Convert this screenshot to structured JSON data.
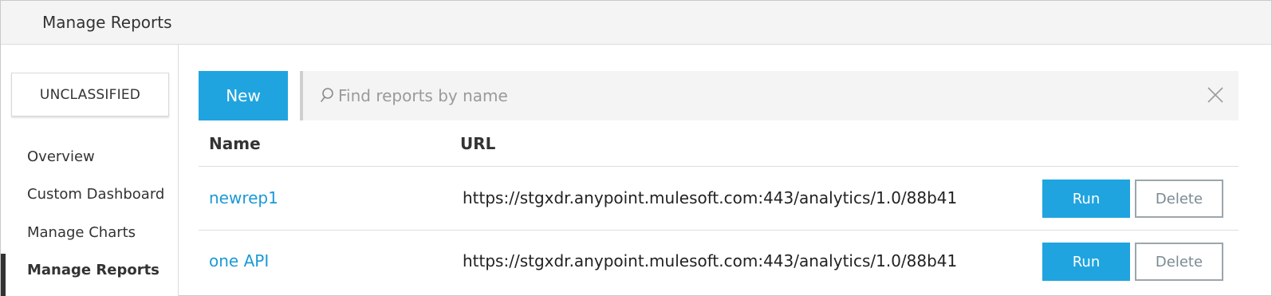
{
  "header": {
    "title": "Manage Reports"
  },
  "sidebar": {
    "environment_label": "UNCLASSIFIED",
    "items": [
      {
        "label": "Overview",
        "active": false
      },
      {
        "label": "Custom Dashboard",
        "active": false
      },
      {
        "label": "Manage Charts",
        "active": false
      },
      {
        "label": "Manage Reports",
        "active": true
      }
    ]
  },
  "toolbar": {
    "new_label": "New",
    "search": {
      "placeholder": "Find reports by name",
      "value": "",
      "icon": "search-icon",
      "clear_icon": "close-icon"
    }
  },
  "table": {
    "columns": [
      "Name",
      "URL"
    ],
    "rows": [
      {
        "name": "newrep1",
        "url": "https://stgxdr.anypoint.mulesoft.com:443/analytics/1.0/88b41",
        "run_label": "Run",
        "delete_label": "Delete"
      },
      {
        "name": "one API",
        "url": "https://stgxdr.anypoint.mulesoft.com:443/analytics/1.0/88b41",
        "run_label": "Run",
        "delete_label": "Delete"
      }
    ]
  },
  "colors": {
    "accent": "#1fa4e0",
    "link": "#1b9ad6",
    "header_bg": "#f4f4f4"
  }
}
